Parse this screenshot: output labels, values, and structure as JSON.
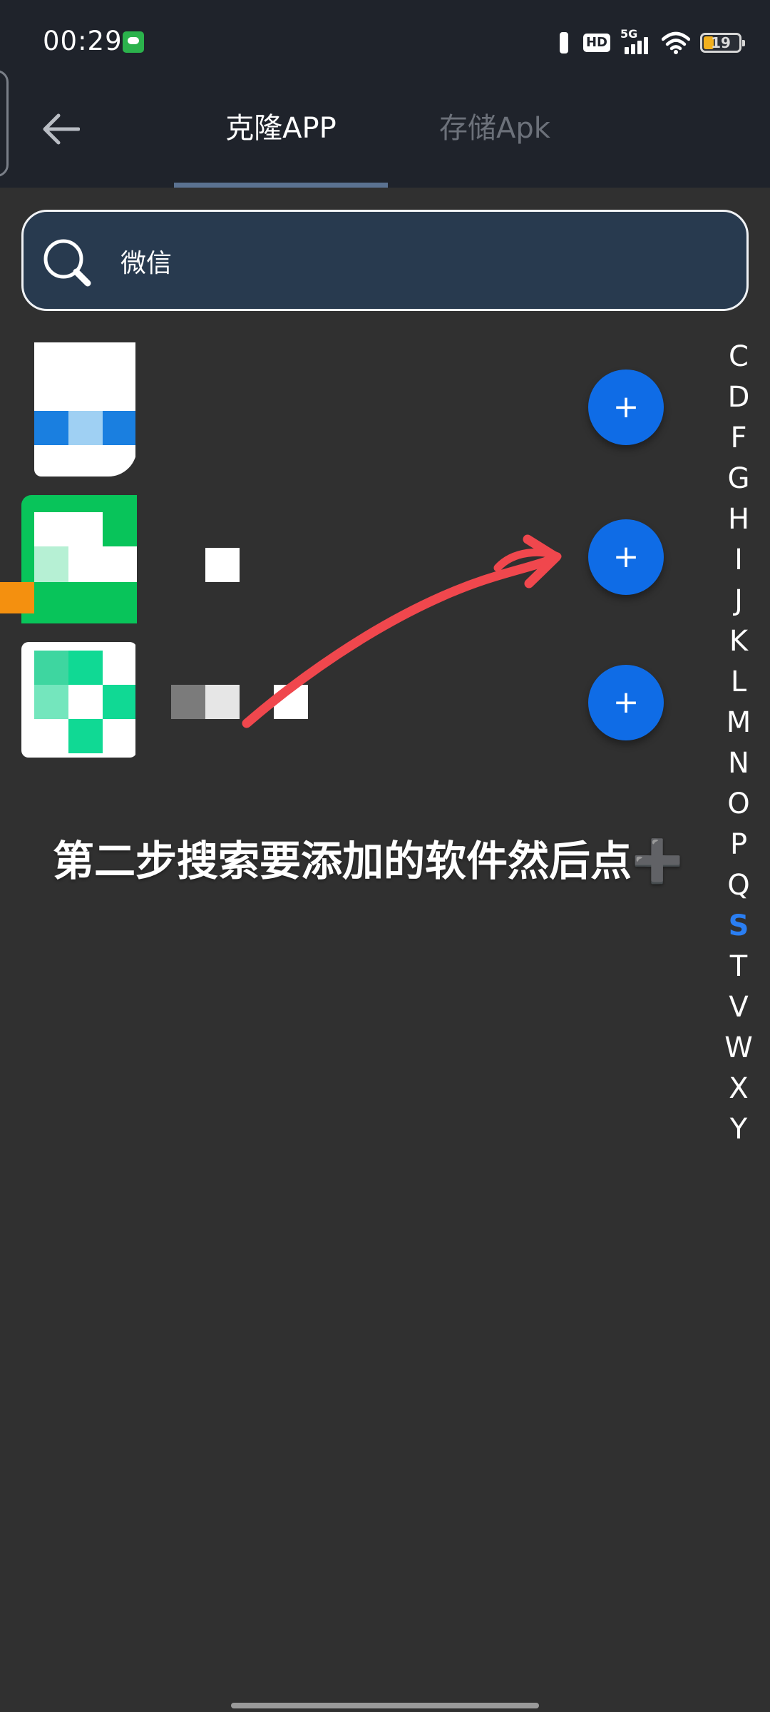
{
  "status_bar": {
    "time": "00:29",
    "network_badge": "HD",
    "network_type": "5G",
    "battery_level": "19"
  },
  "app_bar": {
    "tabs": [
      {
        "label": "克隆APP",
        "selected": true
      },
      {
        "label": "存储Apk",
        "selected": false
      }
    ]
  },
  "search": {
    "value": "微信"
  },
  "app_list": {
    "items": [
      {
        "add_label": "+"
      },
      {
        "add_label": "+"
      },
      {
        "add_label": "+"
      }
    ]
  },
  "annotation": {
    "caption": "第二步搜索要添加的软件然后点",
    "caption_emoji": "➕",
    "arrow_color": "#f0474d"
  },
  "alphabet_index": {
    "letters": [
      "C",
      "D",
      "F",
      "G",
      "H",
      "I",
      "J",
      "K",
      "L",
      "M",
      "N",
      "O",
      "P",
      "Q",
      "S",
      "T",
      "V",
      "W",
      "X",
      "Y"
    ],
    "active": "S"
  },
  "colors": {
    "background": "#303030",
    "header": "#1f232b",
    "accent": "#0f6ce6",
    "index_active": "#2a7ef2"
  }
}
